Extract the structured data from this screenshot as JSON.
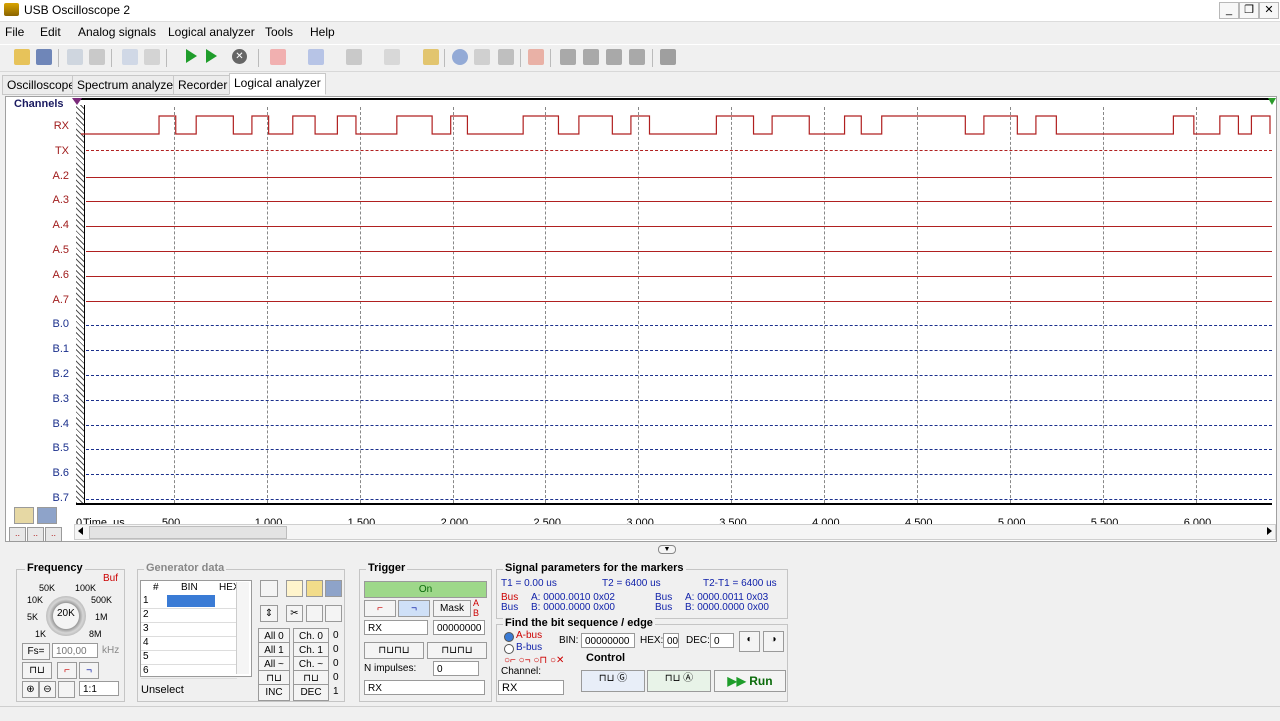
{
  "window": {
    "title": "USB Oscilloscope 2"
  },
  "menu": [
    "File",
    "Edit",
    "Analog signals",
    "Logical analyzer",
    "Tools",
    "Help"
  ],
  "tabs": [
    {
      "label": "Oscilloscope",
      "active": false
    },
    {
      "label": "Spectrum analyzer",
      "active": false
    },
    {
      "label": "Recorder",
      "active": false
    },
    {
      "label": "Logical analyzer",
      "active": true
    }
  ],
  "analyzer": {
    "header": "Channels",
    "channels": [
      "RX",
      "TX",
      "A.2",
      "A.3",
      "A.4",
      "A.5",
      "A.6",
      "A.7",
      "B.0",
      "B.1",
      "B.2",
      "B.3",
      "B.4",
      "B.5",
      "B.6",
      "B.7"
    ],
    "axis_start_label": "0",
    "axis_unit": "Time, us",
    "axis_ticks": [
      "500",
      "1,000",
      "1,500",
      "2,000",
      "2,500",
      "3,000",
      "3,500",
      "4,000",
      "4,500",
      "5,000",
      "5,500",
      "6,000"
    ],
    "axis_tick_values": [
      500,
      1000,
      1500,
      2000,
      2500,
      3000,
      3500,
      4000,
      4500,
      5000,
      5500,
      6000
    ],
    "axis_max": 6400,
    "rx_pulses_us": [
      [
        420,
        510
      ],
      [
        620,
        820
      ],
      [
        920,
        1010
      ],
      [
        1140,
        1260
      ],
      [
        1380,
        1480
      ],
      [
        1700,
        1890
      ],
      [
        1990,
        2080
      ],
      [
        2380,
        2570
      ],
      [
        2680,
        2860
      ],
      [
        2960,
        3060
      ],
      [
        3420,
        3620
      ],
      [
        3720,
        3920
      ],
      [
        4110,
        4200
      ],
      [
        4310,
        4760
      ],
      [
        4860,
        5040
      ],
      [
        5140,
        5250
      ],
      [
        5880,
        5990
      ],
      [
        6130,
        6230
      ],
      [
        6300,
        6400
      ]
    ],
    "colors": {
      "a_bus": "#b02020",
      "b_bus": "#1a2f8c"
    }
  },
  "frequency": {
    "title": "Frequency",
    "buf_label": "Buf",
    "dial_value": "20K",
    "dial_labels": [
      "50K",
      "100K",
      "10K",
      "500K",
      "5K",
      "1M",
      "1K",
      "8M"
    ],
    "fs_label": "Fs=",
    "fs_value": "100,00",
    "fs_unit": "kHz",
    "zoom_ratio": "1:1"
  },
  "generator": {
    "title": "Generator data",
    "columns": [
      "#",
      "BIN",
      "HEX"
    ],
    "rows": [
      "1",
      "2",
      "3",
      "4",
      "5",
      "6"
    ],
    "unselect_label": "Unselect",
    "buttons": {
      "all0": "All 0",
      "all1": "All 1",
      "all_tilde": "All ~",
      "ch0": "Ch. 0",
      "ch1": "Ch. 1",
      "ch_tilde": "Ch. ~",
      "inc": "INC",
      "dec": "DEC"
    },
    "counters": [
      "0",
      "0",
      "0",
      "0",
      "1"
    ]
  },
  "trigger": {
    "title": "Trigger",
    "state": "On",
    "mask_label": "Mask",
    "channel": "RX",
    "mask_value": "00000000",
    "n_impulses_label": "N impulses:",
    "n_impulses_value": "0",
    "channel2": "RX"
  },
  "signal_params": {
    "title": "Signal parameters for the markers",
    "t1": "T1 = 0.00 us",
    "t2": "T2 = 6400 us",
    "t2t1": "T2-T1 = 6400 us",
    "bus_a1_label": "Bus",
    "bus_a1_value": "A: 0000.0010 0x02",
    "bus_b1_label": "Bus",
    "bus_b1_value": "B: 0000.0000 0x00",
    "bus_a2_label": "Bus",
    "bus_a2_value": "A: 0000.0011 0x03",
    "bus_b2_label": "Bus",
    "bus_b2_value": "B: 0000.0000 0x00"
  },
  "find_bits": {
    "title": "Find the bit sequence / edge",
    "a_bus": "A-bus",
    "b_bus": "B-bus",
    "bin_label": "BIN:",
    "bin_value": "00000000",
    "hex_label": "HEX:",
    "hex_value": "00",
    "dec_label": "DEC:",
    "dec_value": "0"
  },
  "control": {
    "title": "Control",
    "channel_label": "Channel:",
    "channel_value": "RX",
    "run_label": "Run"
  }
}
